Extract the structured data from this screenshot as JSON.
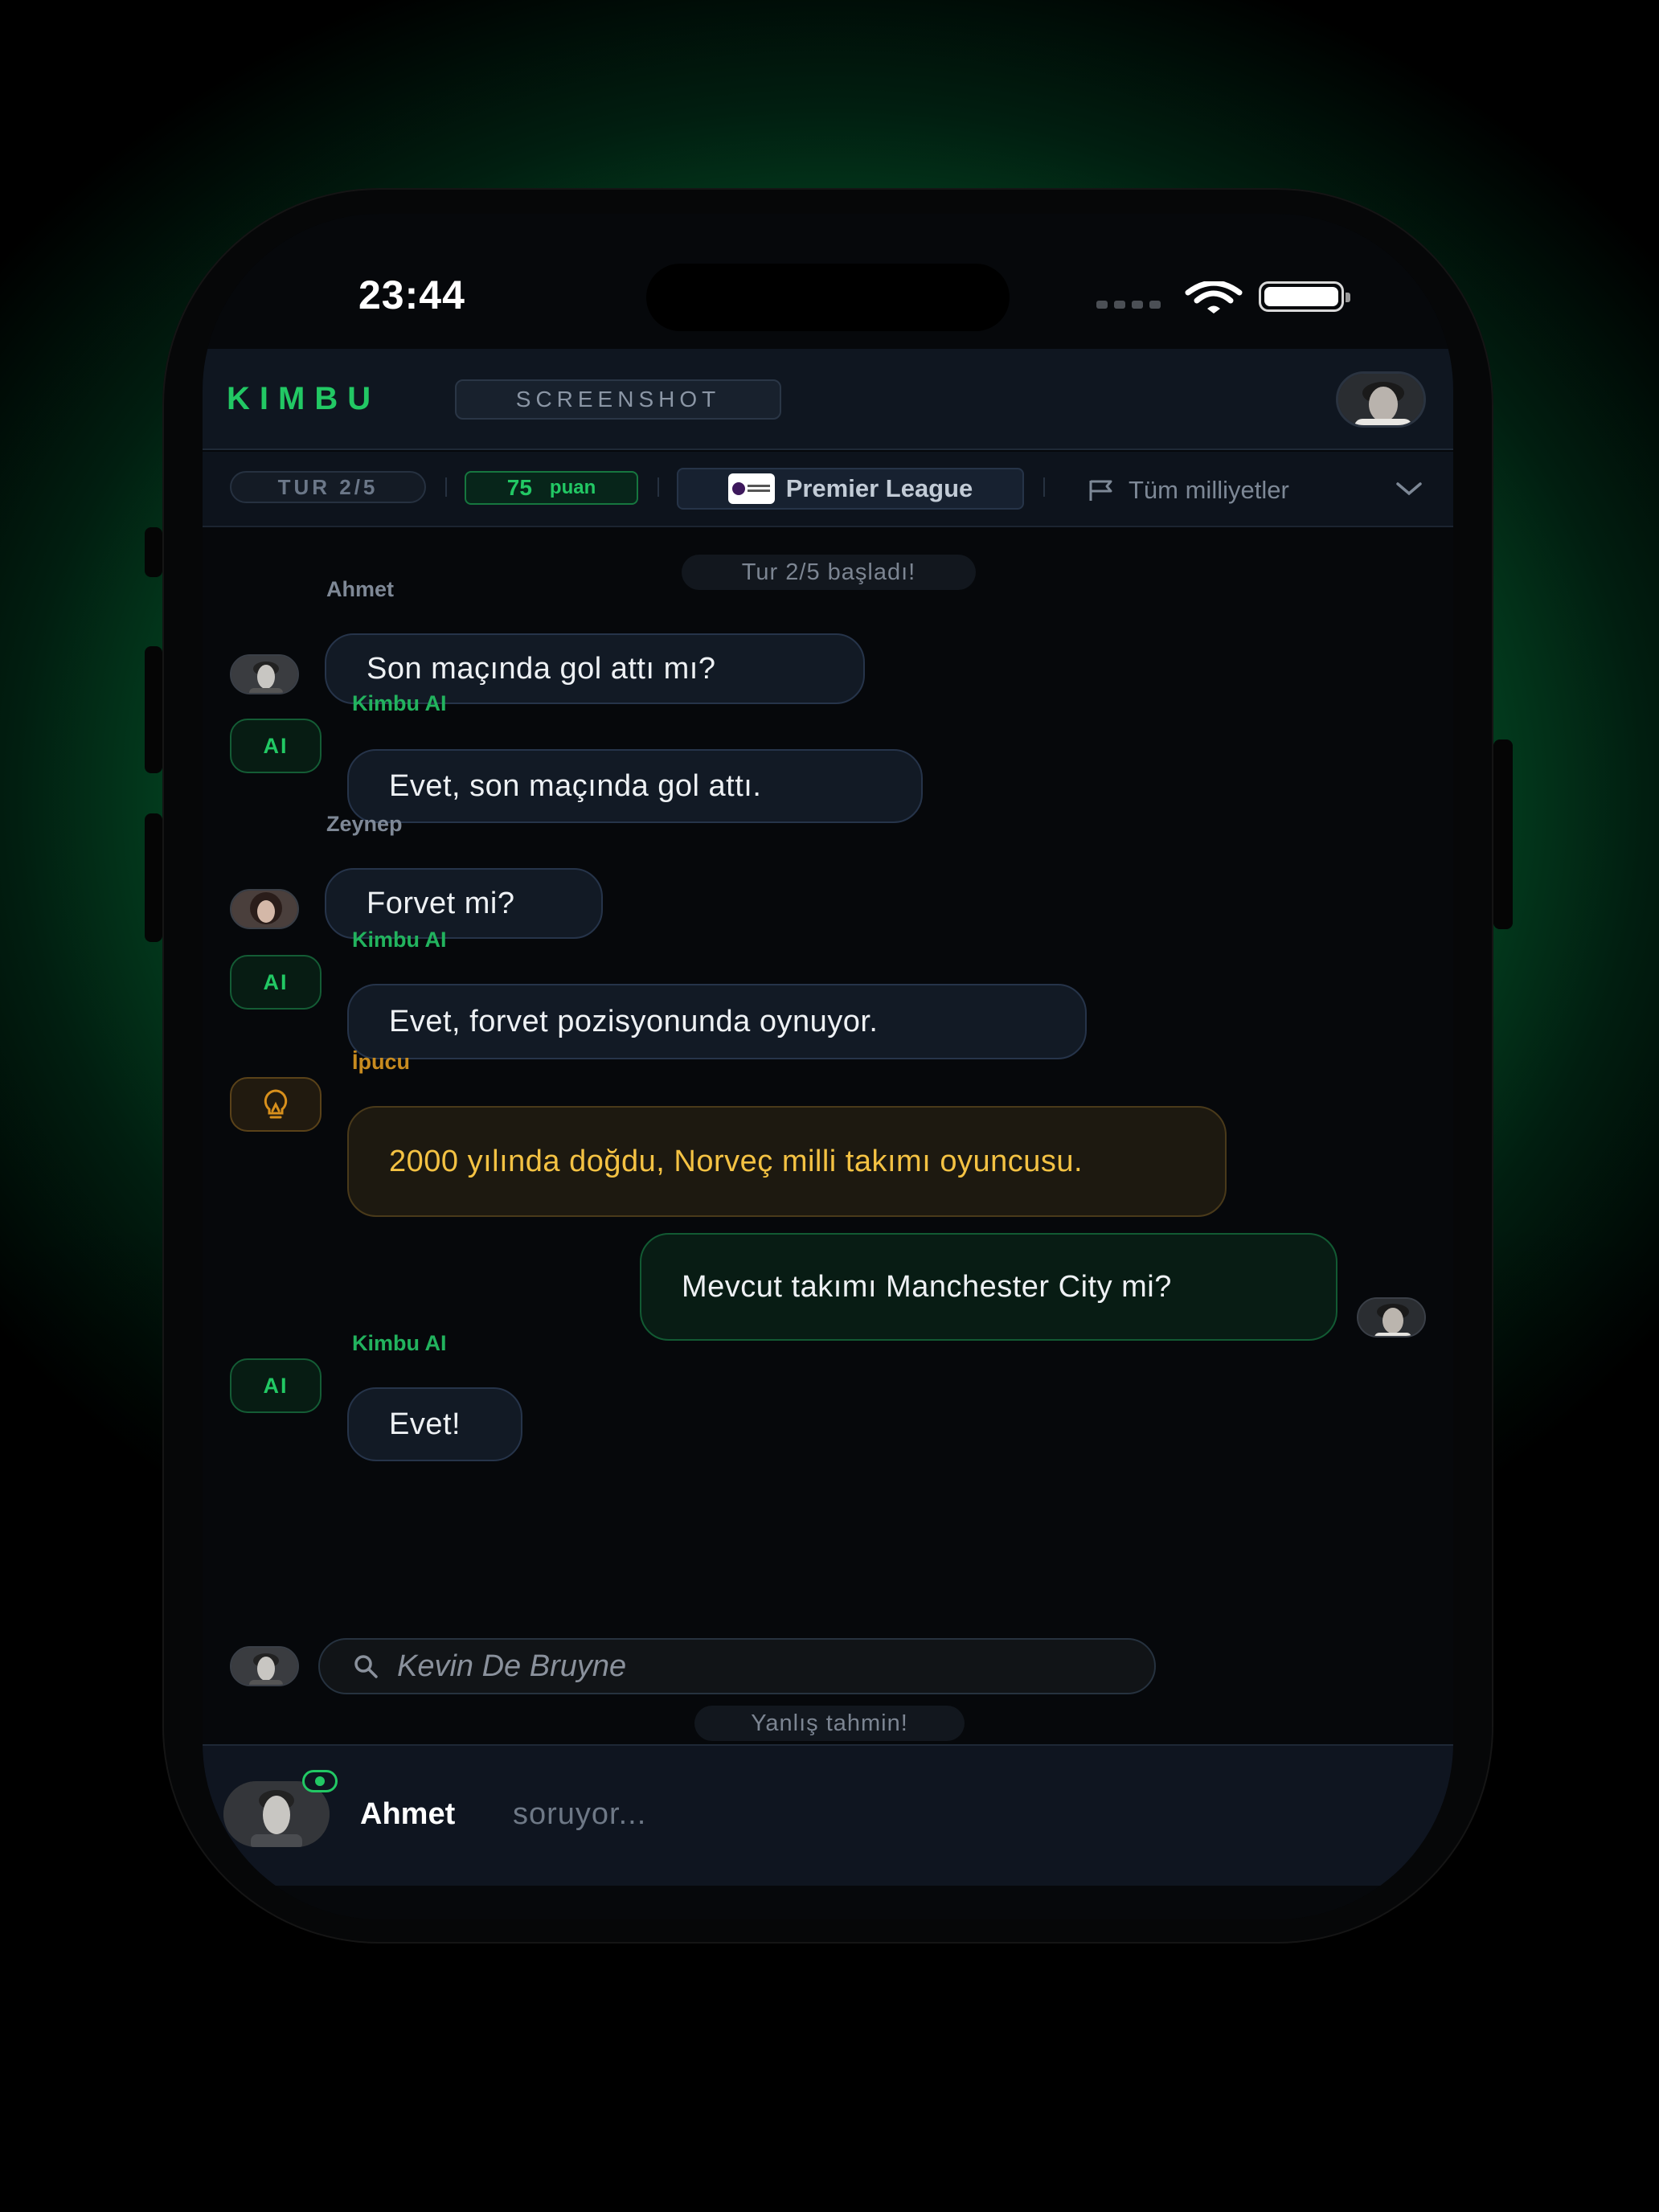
{
  "status_bar": {
    "time": "23:44"
  },
  "header": {
    "logo": "KIMBU",
    "badge": "SCREENSHOT"
  },
  "toolbar": {
    "round": "TUR 2/5",
    "points_value": "75",
    "points_label": "puan",
    "league": "Premier League",
    "nationality": "Tüm milliyetler"
  },
  "chat": {
    "round_started": "Tur 2/5 başladı!",
    "messages": [
      {
        "sender": "Ahmet",
        "text": "Son maçında gol attı mı?"
      },
      {
        "sender": "Kimbu AI",
        "badge": "AI",
        "text": "Evet, son maçında gol attı."
      },
      {
        "sender": "Zeynep",
        "text": "Forvet mi?"
      },
      {
        "sender": "Kimbu AI",
        "badge": "AI",
        "text": "Evet, forvet pozisyonunda oynuyor."
      },
      {
        "sender": "İpucu",
        "text": "2000 yılında doğdu, Norveç milli takımı oyuncusu."
      },
      {
        "text": "Mevcut takımı Manchester City mi?"
      },
      {
        "sender": "Kimbu AI",
        "badge": "AI",
        "text": "Evet!"
      }
    ],
    "guess": "Kevin De Bruyne",
    "guess_result": "Yanlış tahmin!"
  },
  "bottom": {
    "asker": "Ahmet",
    "status": "soruyor..."
  },
  "colors": {
    "accent": "#22c864",
    "hint": "#f4c243",
    "background": "#06080b"
  }
}
